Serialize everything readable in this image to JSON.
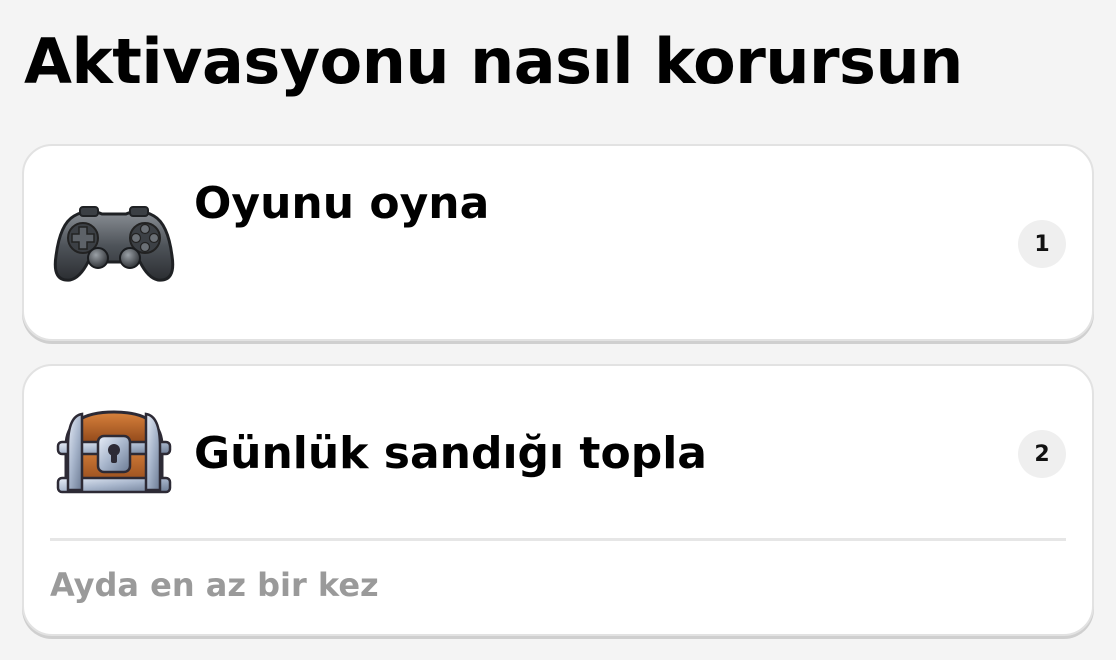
{
  "page": {
    "title": "Aktivasyonu nasıl korursun"
  },
  "steps": [
    {
      "icon": "gamepad-icon",
      "label": "Oyunu oyna",
      "number": "1"
    },
    {
      "icon": "treasure-chest-icon",
      "label": "Günlük sandığı topla",
      "number": "2",
      "note": "Ayda en az bir kez"
    }
  ],
  "colors": {
    "background": "#f4f4f4",
    "card": "#ffffff",
    "note_text": "#9a9a9a",
    "badge_bg": "#efefef"
  }
}
